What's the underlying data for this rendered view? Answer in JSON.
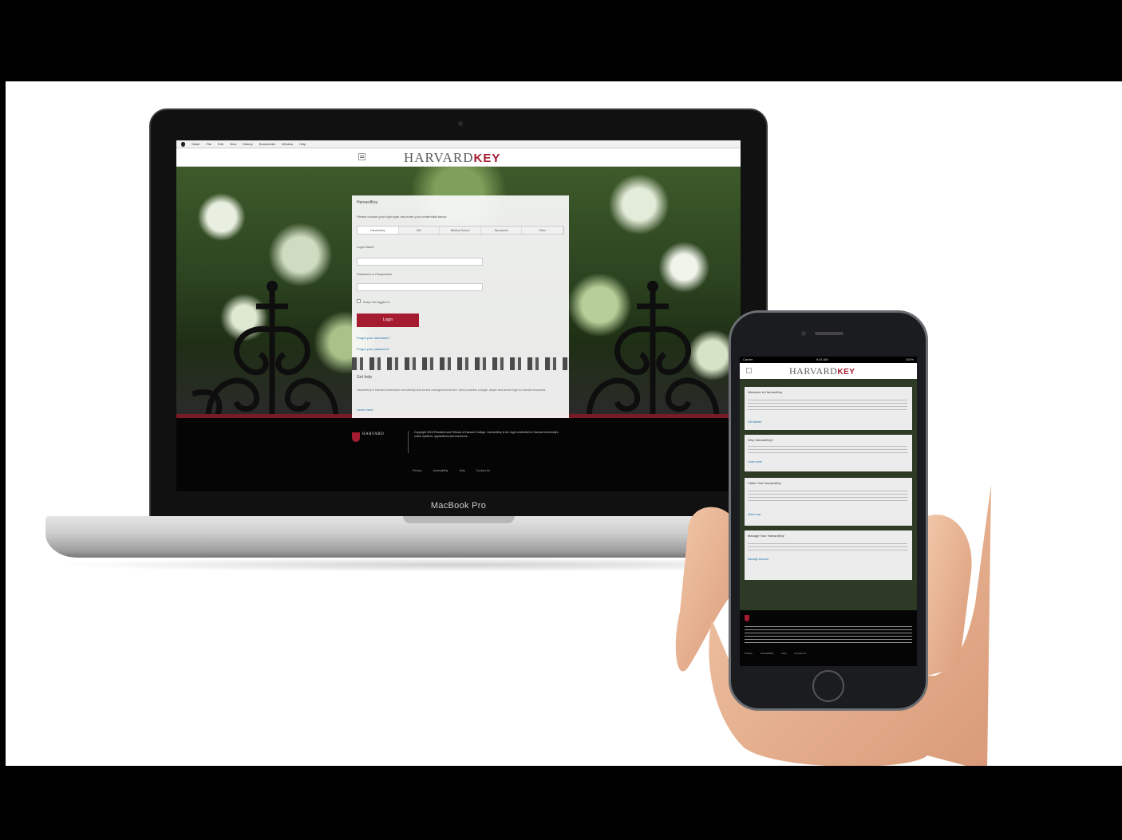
{
  "laptop": {
    "model_label": "MacBook Pro",
    "menubar": [
      "Safari",
      "File",
      "Edit",
      "View",
      "History",
      "Bookmarks",
      "Window",
      "Help"
    ],
    "site": {
      "brand_main": "HARVARD",
      "brand_key": "KEY",
      "login": {
        "title": "HarvardKey",
        "intro": "Please choose your login type and enter your credentials below.",
        "tabs": [
          "HarvardKey",
          "XID",
          "Medical School",
          "Sponsored",
          "Other"
        ],
        "username_label": "Login Name",
        "password_label": "Password or Passphrase",
        "remember_label": "Keep me logged in",
        "login_button": "Login",
        "forgot_username_link": "Forgot your username?",
        "forgot_password_link": "Forgot your password?",
        "help_heading": "Get help",
        "help_text": "HarvardKey is Harvard University's new identity and access management service, which provides a single, simple and secure login to Harvard resources.",
        "help_link": "Learn more"
      },
      "footer": {
        "logo_text": "HARVARD",
        "copyright": "Copyright 2015 President and Fellows of Harvard College. HarvardKey is the login credential for Harvard University's online systems, applications and resources.",
        "links": [
          "Privacy",
          "Accessibility",
          "Help",
          "Contact Us"
        ]
      }
    }
  },
  "phone": {
    "status_time": "9:41 AM",
    "status_carrier": "Carrier",
    "status_battery": "100%",
    "brand_main": "HARVARD",
    "brand_key": "KEY",
    "cards": [
      {
        "heading": "Welcome to HarvardKey",
        "link": "Get started"
      },
      {
        "heading": "Why HarvardKey?",
        "link": "Learn more"
      },
      {
        "heading": "Claim Your HarvardKey",
        "link": "Claim now"
      },
      {
        "heading": "Manage Your HarvardKey",
        "link": "Manage account"
      }
    ],
    "footer_links": [
      "Privacy",
      "Accessibility",
      "Help",
      "Contact Us"
    ]
  }
}
